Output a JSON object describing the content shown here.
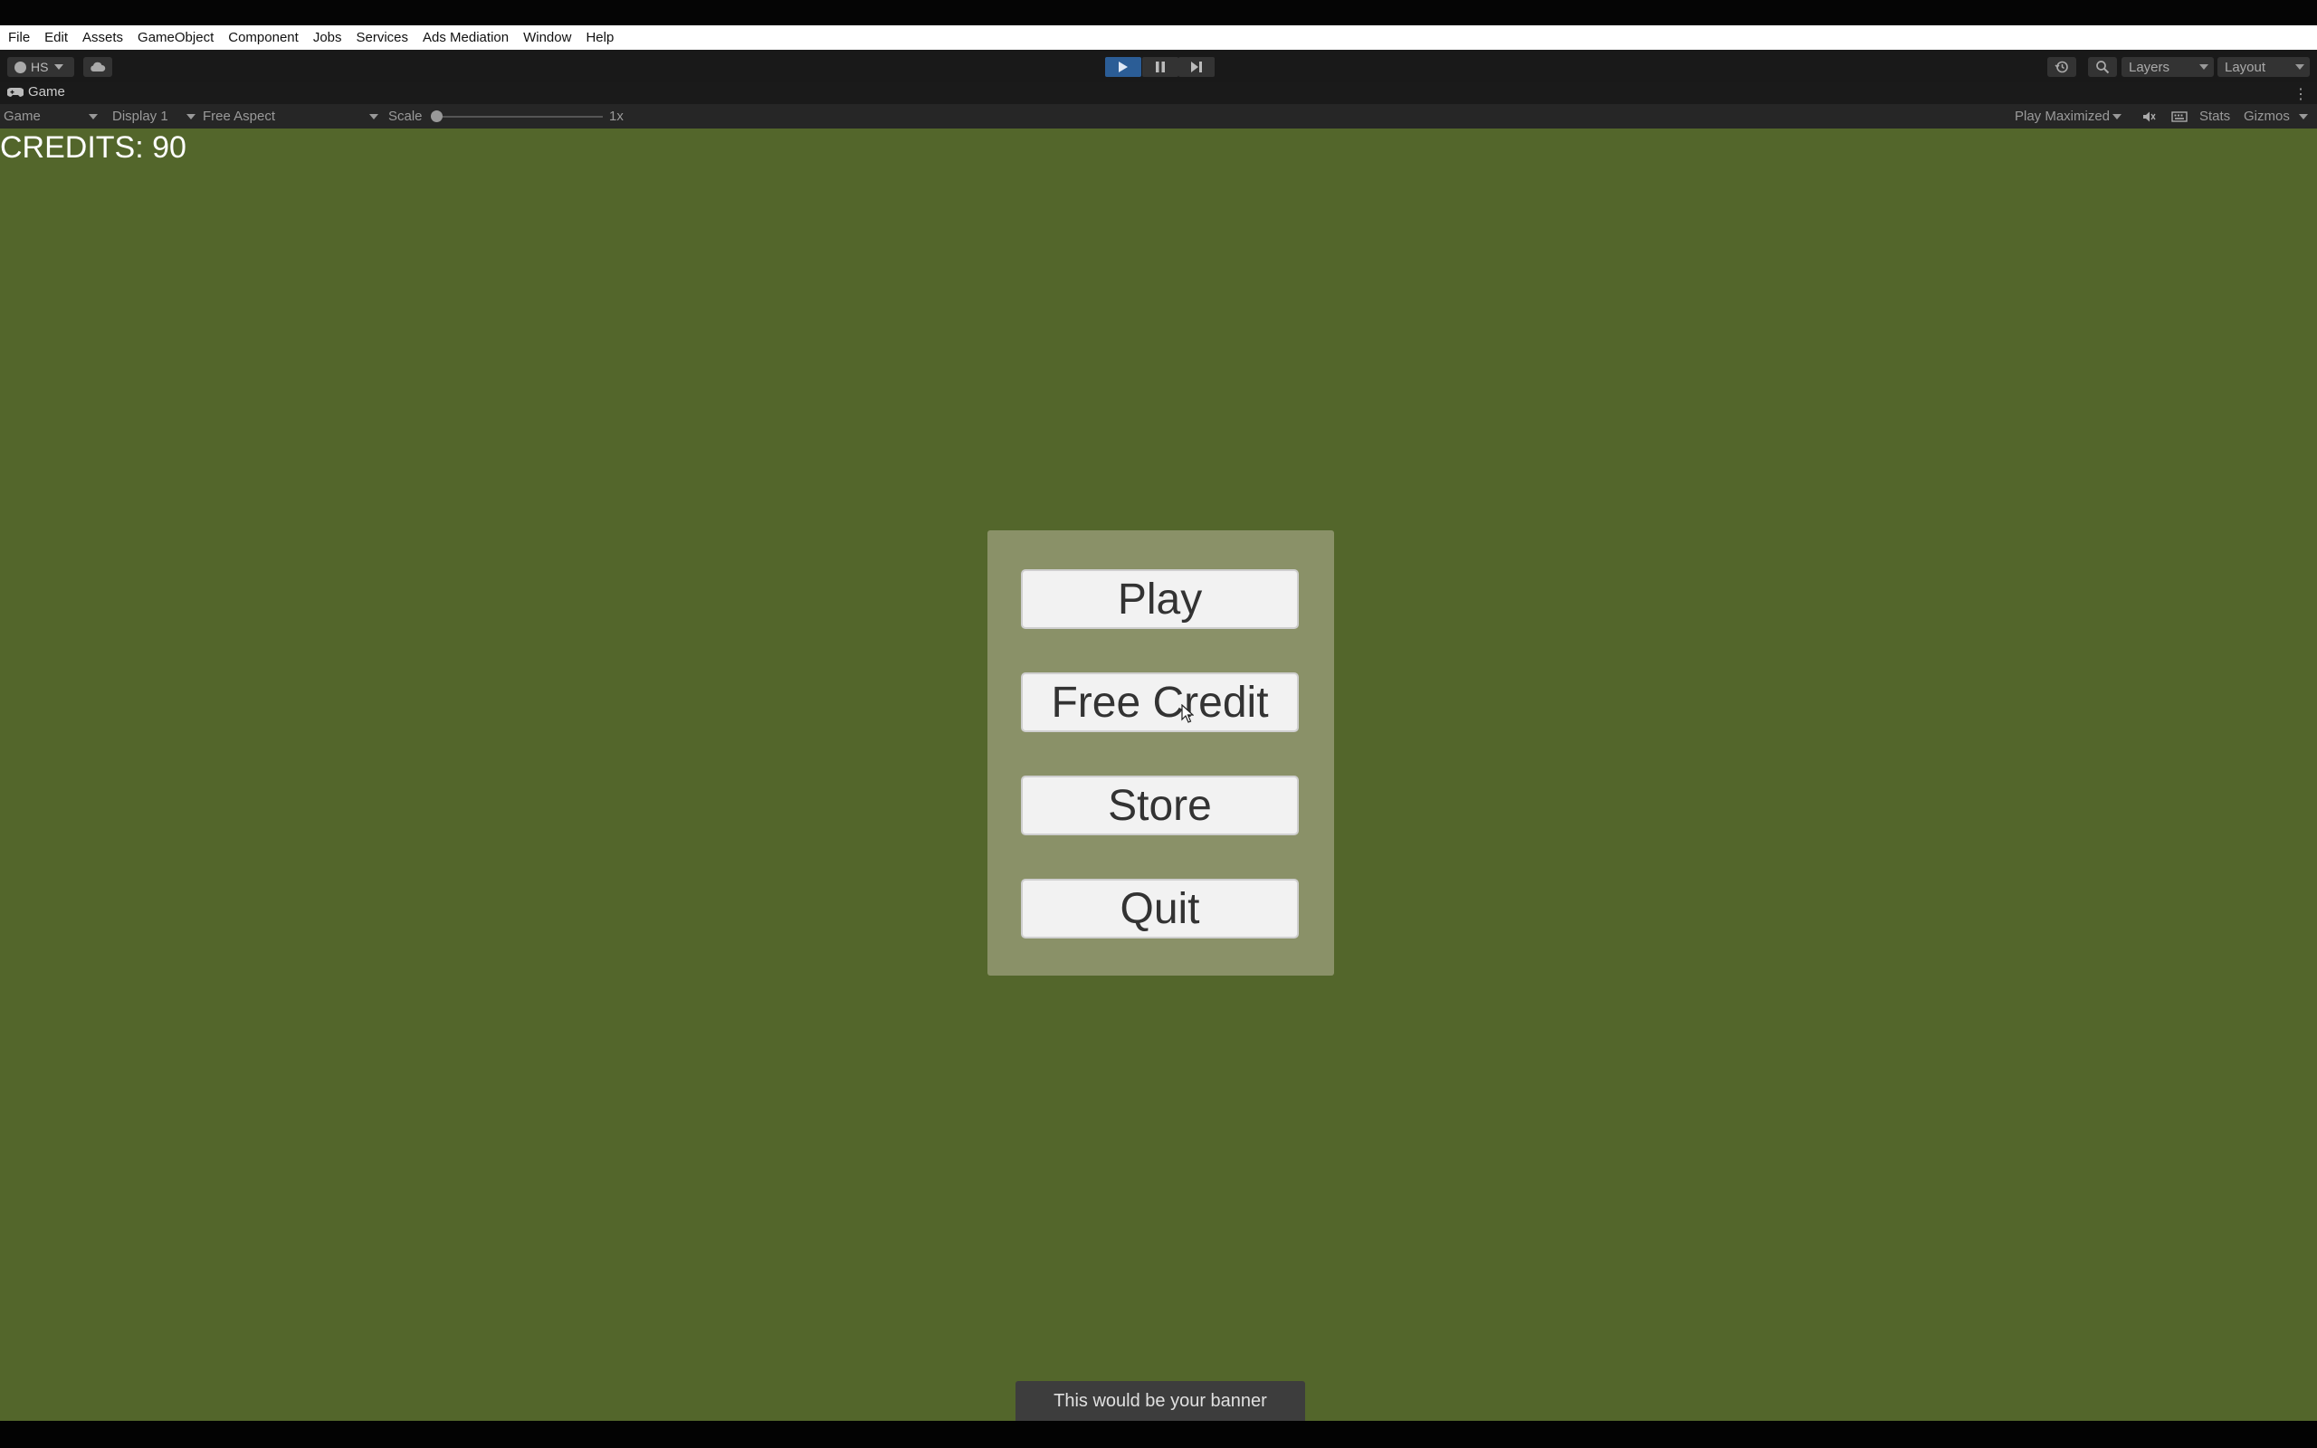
{
  "menu": [
    "File",
    "Edit",
    "Assets",
    "GameObject",
    "Component",
    "Jobs",
    "Services",
    "Ads Mediation",
    "Window",
    "Help"
  ],
  "toolbar": {
    "account_label": "HS",
    "layers_label": "Layers",
    "layout_label": "Layout",
    "play_active_color": "#2b5d96",
    "icons": [
      "cloud-icon",
      "play-icon",
      "pause-icon",
      "step-icon",
      "history-icon",
      "search-icon"
    ]
  },
  "tab": {
    "title": "Game"
  },
  "gamebar": {
    "view": "Game",
    "display": "Display 1",
    "aspect": "Free Aspect",
    "scale_label": "Scale",
    "scale_value": "1x",
    "play_mode": "Play Maximized",
    "stats": "Stats",
    "gizmos": "Gizmos"
  },
  "game": {
    "background_color": "#53662b",
    "credits": "CREDITS: 90",
    "buttons": [
      "Play",
      "Free Credit",
      "Store",
      "Quit"
    ],
    "banner": "This would be your banner"
  }
}
